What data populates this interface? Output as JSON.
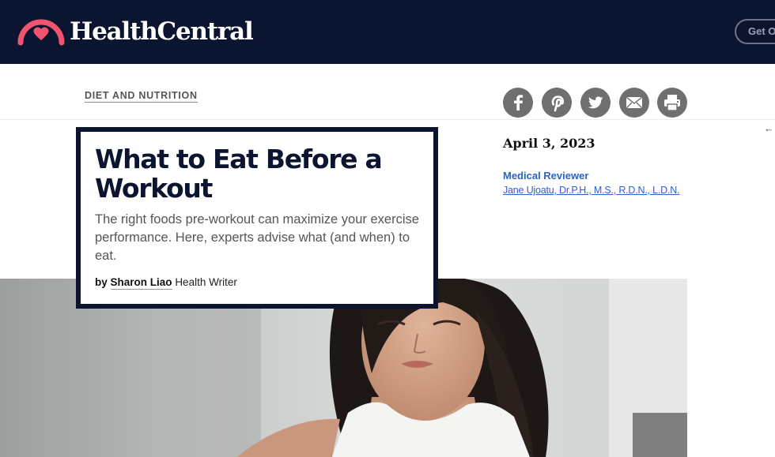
{
  "header": {
    "logo_text": "HealthCentral",
    "cta_label": "Get O"
  },
  "article": {
    "category": "DIET AND NUTRITION",
    "title": "What to Eat Before a Workout",
    "dek": "The right foods pre-workout can maximize your exercise performance. Here, experts advise what (and when) to eat.",
    "byline_prefix": "by",
    "author": "Sharon Liao",
    "author_role": "Health Writer",
    "date": "April 3, 2023",
    "reviewer_label": "Medical Reviewer",
    "reviewer_name": "Jane Ujoatu, Dr.P.H., M.S., R.D.N., L.D.N."
  },
  "share_icons": [
    "facebook-icon",
    "pinterest-icon",
    "twitter-icon",
    "email-icon",
    "print-icon"
  ],
  "side_icon": "arrow-left-icon",
  "side_glyph": "←",
  "colors": {
    "header_bg": "#0c1530",
    "logo_accent": "#f0546e",
    "link_blue": "#2b63c7",
    "share_gray": "#6f6f6f"
  }
}
